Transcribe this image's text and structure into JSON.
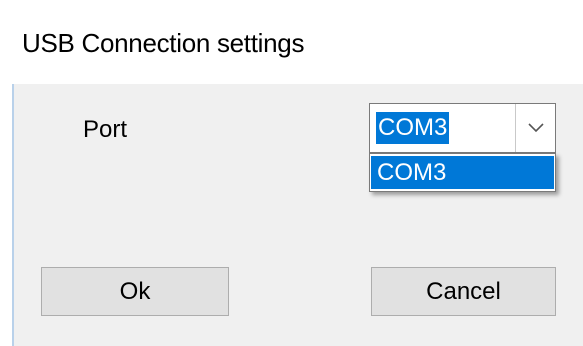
{
  "window": {
    "title": "USB Connection settings"
  },
  "port": {
    "label": "Port",
    "selected_value": "COM3",
    "options": [
      "COM3"
    ],
    "dropdown_icon": "chevron-down-icon"
  },
  "buttons": {
    "ok_label": "Ok",
    "cancel_label": "Cancel"
  },
  "colors": {
    "selection": "#0078d7",
    "dialog_background": "#f0f0f0",
    "button_face": "#e1e1e1"
  }
}
